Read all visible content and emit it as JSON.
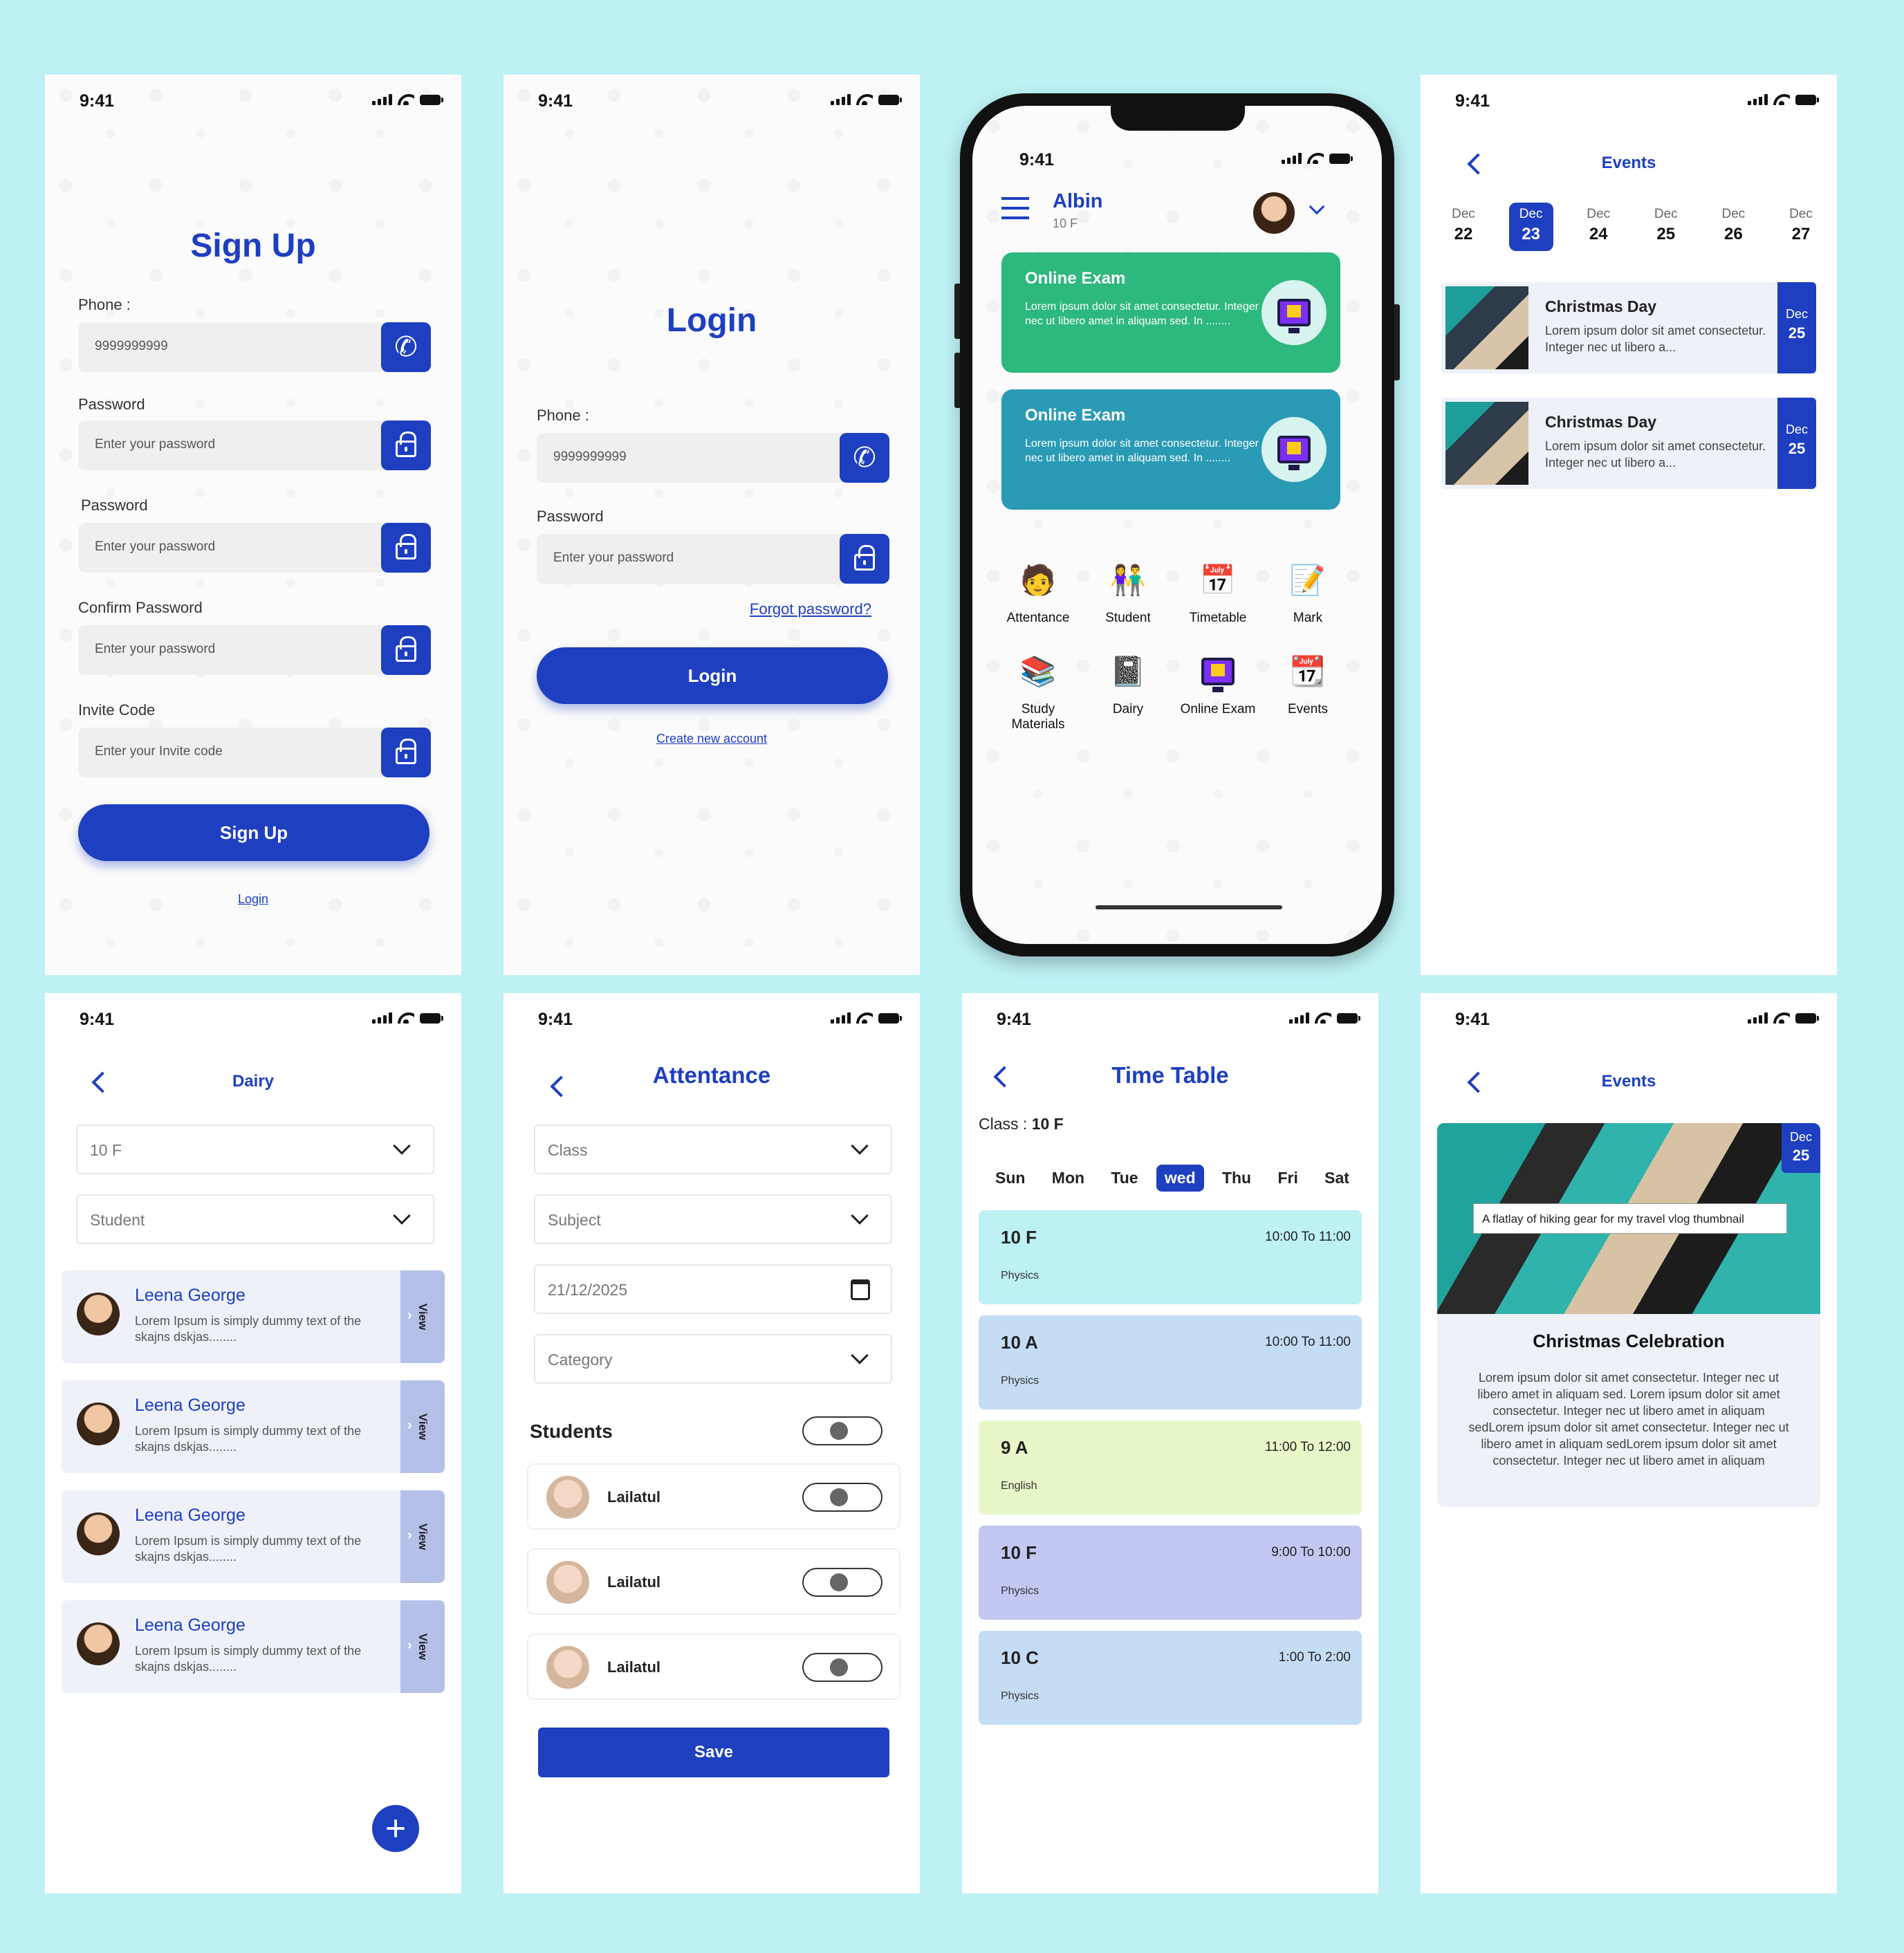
{
  "status_time": "9:41",
  "signup": {
    "title": "Sign Up",
    "phone_label": "Phone :",
    "phone_value": "9999999999",
    "password_label": "Password",
    "password_label2": "Password",
    "confirm_label": "Confirm Password",
    "invite_label": "Invite Code",
    "password_placeholder": "Enter your password",
    "invite_placeholder": "Enter your Invite code",
    "button": "Sign Up",
    "login_link": "Login"
  },
  "login": {
    "title": "Login",
    "phone_label": "Phone :",
    "phone_value": "9999999999",
    "password_label": "Password",
    "password_placeholder": "Enter your password",
    "forgot": "Forgot password?",
    "button": "Login",
    "create": "Create new account"
  },
  "home": {
    "user_name": "Albin",
    "user_class": "10 F",
    "cards": [
      {
        "title": "Online Exam",
        "desc": "Lorem ipsum dolor sit amet consectetur. Integer nec ut libero amet in aliquam sed. In ........",
        "color": "#2db87e"
      },
      {
        "title": "Online Exam",
        "desc": "Lorem ipsum dolor sit amet consectetur. Integer nec ut libero amet in aliquam sed. In ........",
        "color": "#2a9bb5"
      }
    ],
    "menu": [
      "Attentance",
      "Student",
      "Timetable",
      "Mark",
      "Study Materials",
      "Dairy",
      "Online Exam",
      "Events"
    ]
  },
  "events": {
    "title": "Events",
    "dates": [
      {
        "m": "Dec",
        "d": "22"
      },
      {
        "m": "Dec",
        "d": "23"
      },
      {
        "m": "Dec",
        "d": "24"
      },
      {
        "m": "Dec",
        "d": "25"
      },
      {
        "m": "Dec",
        "d": "26"
      },
      {
        "m": "Dec",
        "d": "27"
      }
    ],
    "items": [
      {
        "title": "Christmas Day",
        "desc": "Lorem ipsum dolor sit amet consectetur. Integer nec ut libero a...",
        "m": "Dec",
        "d": "25"
      },
      {
        "title": "Christmas Day",
        "desc": "Lorem ipsum dolor sit amet consectetur. Integer nec ut libero a...",
        "m": "Dec",
        "d": "25"
      }
    ]
  },
  "dairy": {
    "title": "Dairy",
    "class_select": "10 F",
    "student_select": "Student",
    "entries": [
      {
        "name": "Leena George",
        "desc": "Lorem Ipsum is simply dummy text of the skajns dskjas........",
        "view": "View"
      },
      {
        "name": "Leena George",
        "desc": "Lorem Ipsum is simply dummy text of the skajns dskjas........",
        "view": "View"
      },
      {
        "name": "Leena George",
        "desc": "Lorem Ipsum is simply dummy text of the skajns dskjas........",
        "view": "View"
      },
      {
        "name": "Leena George",
        "desc": "Lorem Ipsum is simply dummy text of the skajns dskjas........",
        "view": "View"
      }
    ],
    "fab": "+"
  },
  "attendance": {
    "title": "Attentance",
    "class": "Class",
    "subject": "Subject",
    "date": "21/12/2025",
    "category": "Category",
    "students_label": "Students",
    "students": [
      "Lailatul",
      "Lailatul",
      "Lailatul"
    ],
    "save": "Save"
  },
  "timetable": {
    "title": "Time Table",
    "class_label": "Class :",
    "class_value": "10 F",
    "days": [
      "Sun",
      "Mon",
      "Tue",
      "wed",
      "Thu",
      "Fri",
      "Sat"
    ],
    "selected_day": "wed",
    "slots": [
      {
        "cls": "10 F",
        "time": "10:00 To 11:00",
        "sub": "Physics",
        "color": "#bdf1f4"
      },
      {
        "cls": "10 A",
        "time": "10:00 To 11:00",
        "sub": "Physics",
        "color": "#c5dcf5"
      },
      {
        "cls": "9 A",
        "time": "11:00 To 12:00",
        "sub": "English",
        "color": "#e8f7c8"
      },
      {
        "cls": "10 F",
        "time": "9:00 To 10:00",
        "sub": "Physics",
        "color": "#c3c8f2"
      },
      {
        "cls": "10 C",
        "time": "1:00 To 2:00",
        "sub": "Physics",
        "color": "#c5dcf5"
      }
    ]
  },
  "event_detail": {
    "title": "Events",
    "m": "Dec",
    "d": "25",
    "caption": "A flatlay of hiking gear for my travel vlog thumbnail",
    "heading": "Christmas Celebration",
    "body": "Lorem ipsum dolor sit amet consectetur. Integer nec ut libero amet in aliquam sed. Lorem ipsum dolor sit amet consectetur. Integer nec ut libero amet in aliquam sedLorem ipsum dolor sit amet consectetur. Integer nec ut libero amet in aliquam sedLorem ipsum dolor sit amet consectetur. Integer nec ut libero amet in aliquam"
  }
}
